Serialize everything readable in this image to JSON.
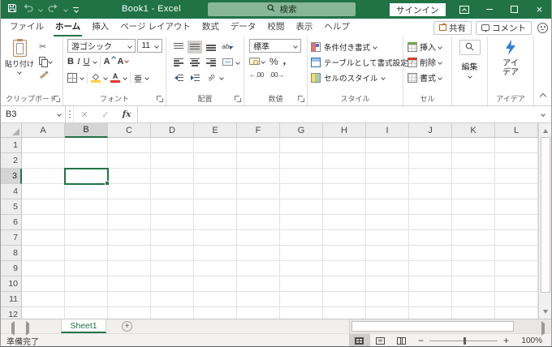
{
  "window": {
    "title": "Book1  -  Excel",
    "search_placeholder": "検索",
    "signin": "サインイン",
    "close_glyph": "×"
  },
  "tabs": {
    "file": "ファイル",
    "home": "ホーム",
    "insert": "挿入",
    "page_layout": "ページ レイアウト",
    "formulas": "数式",
    "data": "データ",
    "review": "校閲",
    "view": "表示",
    "help": "ヘルプ",
    "share": "共有",
    "comments": "コメント"
  },
  "ribbon": {
    "clipboard": {
      "paste": "貼り付け",
      "group": "クリップボード"
    },
    "font": {
      "family": "游ゴシック",
      "size": "11",
      "bold": "B",
      "italic": "I",
      "underline": "U",
      "increase": "A",
      "decrease": "A",
      "phonetic": "亜",
      "group": "フォント"
    },
    "alignment": {
      "wrap_text": "ab",
      "orientation": "ab",
      "group": "配置"
    },
    "number": {
      "format": "標準",
      "percent": "%",
      "comma": ",",
      "increase_decimal": "←.00",
      "decrease_decimal": ".00→",
      "group": "数値"
    },
    "styles": {
      "conditional": "条件付き書式",
      "format_table": "テーブルとして書式設定",
      "cell_styles": "セルのスタイル",
      "group": "スタイル"
    },
    "cells": {
      "insert": "挿入",
      "delete": "削除",
      "format": "書式",
      "group": "セル"
    },
    "editing": {
      "label": "編集"
    },
    "ideas": {
      "button": "アイデア",
      "group": "アイデア"
    }
  },
  "formula_bar": {
    "name_box": "B3",
    "fx": "fx"
  },
  "grid": {
    "columns": [
      "A",
      "B",
      "C",
      "D",
      "E",
      "F",
      "G",
      "H",
      "I",
      "J",
      "K",
      "L"
    ],
    "rows": [
      "1",
      "2",
      "3",
      "4",
      "5",
      "6",
      "7",
      "8",
      "9",
      "10",
      "11",
      "12"
    ],
    "selected_column": "B",
    "selected_row": "3",
    "selected_cell": "B3"
  },
  "sheet_bar": {
    "sheet1": "Sheet1"
  },
  "status_bar": {
    "ready": "準備完了",
    "zoom_level": "100%"
  }
}
